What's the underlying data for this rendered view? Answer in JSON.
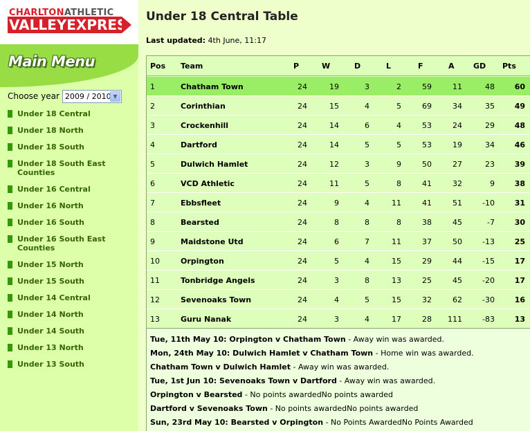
{
  "logo": {
    "line1_red": "CHARLTON",
    "line1_grey": "ATHLETIC",
    "line2": "VALLEYEXPRESS"
  },
  "menu": {
    "title": "Main Menu"
  },
  "year": {
    "label": "Choose year",
    "selected": "2009 / 2010"
  },
  "nav": [
    "Under 18 Central",
    "Under 18 North",
    "Under 18 South",
    "Under 18 South East Counties",
    "Under 16 Central",
    "Under 16 North",
    "Under 16 South",
    "Under 16 South East Counties",
    "Under 15 North",
    "Under 15 South",
    "Under 14 Central",
    "Under 14 North",
    "Under 14 South",
    "Under 13 North",
    "Under 13 South"
  ],
  "page": {
    "title": "Under 18 Central Table",
    "updated_label": "Last updated:",
    "updated_value": " 4th June, 11:17"
  },
  "table": {
    "headers": [
      "Pos",
      "Team",
      "P",
      "W",
      "D",
      "L",
      "F",
      "A",
      "GD",
      "Pts"
    ],
    "rows": [
      [
        "1",
        "Chatham Town",
        "24",
        "19",
        "3",
        "2",
        "59",
        "11",
        "48",
        "60"
      ],
      [
        "2",
        "Corinthian",
        "24",
        "15",
        "4",
        "5",
        "69",
        "34",
        "35",
        "49"
      ],
      [
        "3",
        "Crockenhill",
        "24",
        "14",
        "6",
        "4",
        "53",
        "24",
        "29",
        "48"
      ],
      [
        "4",
        "Dartford",
        "24",
        "14",
        "5",
        "5",
        "53",
        "19",
        "34",
        "46"
      ],
      [
        "5",
        "Dulwich Hamlet",
        "24",
        "12",
        "3",
        "9",
        "50",
        "27",
        "23",
        "39"
      ],
      [
        "6",
        "VCD Athletic",
        "24",
        "11",
        "5",
        "8",
        "41",
        "32",
        "9",
        "38"
      ],
      [
        "7",
        "Ebbsfleet",
        "24",
        "9",
        "4",
        "11",
        "41",
        "51",
        "-10",
        "31"
      ],
      [
        "8",
        "Bearsted",
        "24",
        "8",
        "8",
        "8",
        "38",
        "45",
        "-7",
        "30"
      ],
      [
        "9",
        "Maidstone Utd",
        "24",
        "6",
        "7",
        "11",
        "37",
        "50",
        "-13",
        "25"
      ],
      [
        "10",
        "Orpington",
        "24",
        "5",
        "4",
        "15",
        "29",
        "44",
        "-15",
        "17"
      ],
      [
        "11",
        "Tonbridge Angels",
        "24",
        "3",
        "8",
        "13",
        "25",
        "45",
        "-20",
        "17"
      ],
      [
        "12",
        "Sevenoaks Town",
        "24",
        "4",
        "5",
        "15",
        "32",
        "62",
        "-30",
        "16"
      ],
      [
        "13",
        "Guru Nanak",
        "24",
        "3",
        "4",
        "17",
        "28",
        "111",
        "-83",
        "13"
      ]
    ],
    "highlight_row": 0
  },
  "notes": [
    {
      "bold": "Tue, 11th May 10: Orpington v Chatham Town",
      "text": " - Away win was awarded."
    },
    {
      "bold": "Mon, 24th May 10: Dulwich Hamlet v Chatham Town",
      "text": " - Home win was awarded."
    },
    {
      "bold": "Chatham Town v Dulwich Hamlet",
      "text": " - Away win was awarded."
    },
    {
      "bold": "Tue, 1st Jun 10: Sevenoaks Town v Dartford",
      "text": " - Away win was awarded."
    },
    {
      "bold": "Orpington v Bearsted",
      "text": " - No points awardedNo points awarded"
    },
    {
      "bold": "Dartford v Sevenoaks Town",
      "text": " - No points awardedNo points awarded"
    },
    {
      "bold": "Sun, 23rd May 10: Bearsted v Orpington",
      "text": " - No Points AwardedNo Points Awarded"
    }
  ],
  "colors": {
    "sidebar_bg": "#ddffaa",
    "banner": "#99dd44",
    "highlight": "#99ee66",
    "nav_text": "#336600",
    "brand_red": "#d6202a"
  }
}
